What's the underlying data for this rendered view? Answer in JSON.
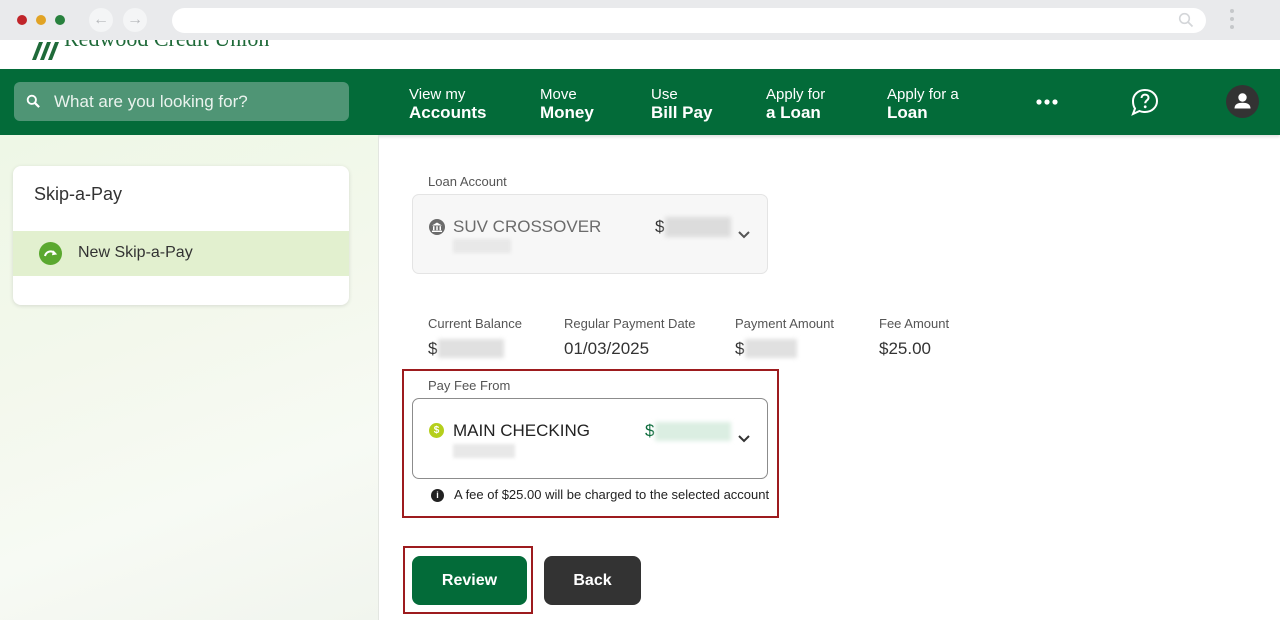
{
  "browser": {
    "back_glyph": "←",
    "forward_glyph": "→"
  },
  "brand": {
    "name": "Redwood Credit Union",
    "color": "#036b39"
  },
  "search": {
    "placeholder": "What are you looking for?"
  },
  "nav": [
    {
      "line1": "View my",
      "line2": "Accounts"
    },
    {
      "line1": "Move",
      "line2": "Money"
    },
    {
      "line1": "Use",
      "line2": "Bill Pay"
    },
    {
      "line1": "Apply for",
      "line2": "a Loan"
    },
    {
      "line1": "Apply for a",
      "line2": "Loan"
    }
  ],
  "icons": {
    "more": "more-horizontal-icon",
    "help": "chat-help-icon",
    "profile": "user-avatar-icon"
  },
  "sidebar": {
    "title": "Skip-a-Pay",
    "items": [
      {
        "label": "New Skip-a-Pay",
        "icon": "arrow-curve-icon"
      }
    ]
  },
  "form": {
    "loan_account_label": "Loan Account",
    "loan_account": {
      "name": "SUV CROSSOVER",
      "currency": "$"
    },
    "summary": [
      {
        "label": "Current Balance",
        "value": "$"
      },
      {
        "label": "Regular Payment Date",
        "value": "01/03/2025"
      },
      {
        "label": "Payment Amount",
        "value": "$"
      },
      {
        "label": "Fee Amount",
        "value": "$25.00"
      }
    ],
    "pay_fee_from_label": "Pay Fee From",
    "pay_fee_from": {
      "name": "MAIN CHECKING",
      "currency": "$",
      "icon_glyph": "$"
    },
    "info_glyph": "i",
    "fee_notice": "A fee of $25.00 will be charged to the selected account"
  },
  "buttons": {
    "review": "Review",
    "back": "Back"
  },
  "colors": {
    "nav_green": "#036b39",
    "highlight_red": "#9d1b1e",
    "sidebar_active": "#e2f0cf",
    "fee_icon": "#b5cf1c"
  }
}
